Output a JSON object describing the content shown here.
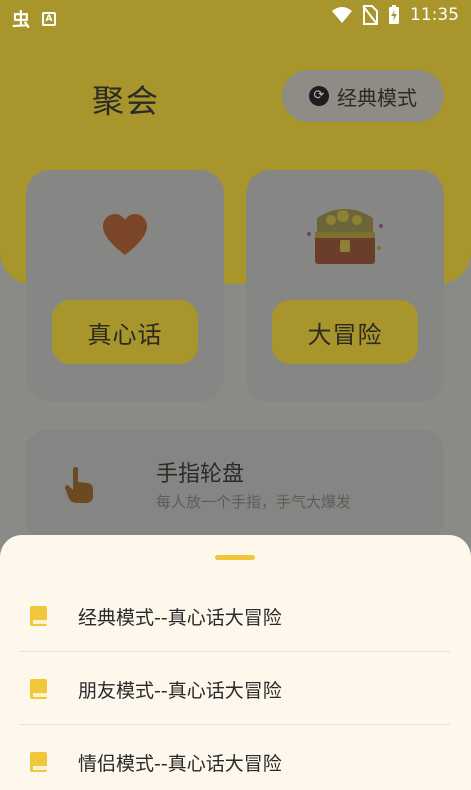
{
  "status_bar": {
    "time": "11:35",
    "left_icons": [
      "bug-icon",
      "a-box-icon"
    ],
    "right_icons": [
      "wifi-icon",
      "no-sim-icon",
      "battery-charging-icon"
    ]
  },
  "header": {
    "title": "聚会",
    "mode_button_label": "经典模式",
    "mode_icon": "refresh-icon"
  },
  "cards": {
    "truth": {
      "icon": "heart-icon",
      "button_label": "真心话"
    },
    "dare": {
      "icon": "treasure-chest-icon",
      "button_label": "大冒险"
    }
  },
  "wheel": {
    "icon": "pointing-finger-icon",
    "title": "手指轮盘",
    "subtitle": "每人放一个手指，手气大爆发"
  },
  "sheet": {
    "items": [
      {
        "label": "经典模式--真心话大冒险",
        "icon": "book-icon"
      },
      {
        "label": "朋友模式--真心话大冒险",
        "icon": "book-icon"
      },
      {
        "label": "情侣模式--真心话大冒险",
        "icon": "book-icon"
      }
    ]
  },
  "colors": {
    "accent": "#f0c63a",
    "sheet_bg": "#fdf7ec",
    "overlay_header": "#a8952c"
  }
}
